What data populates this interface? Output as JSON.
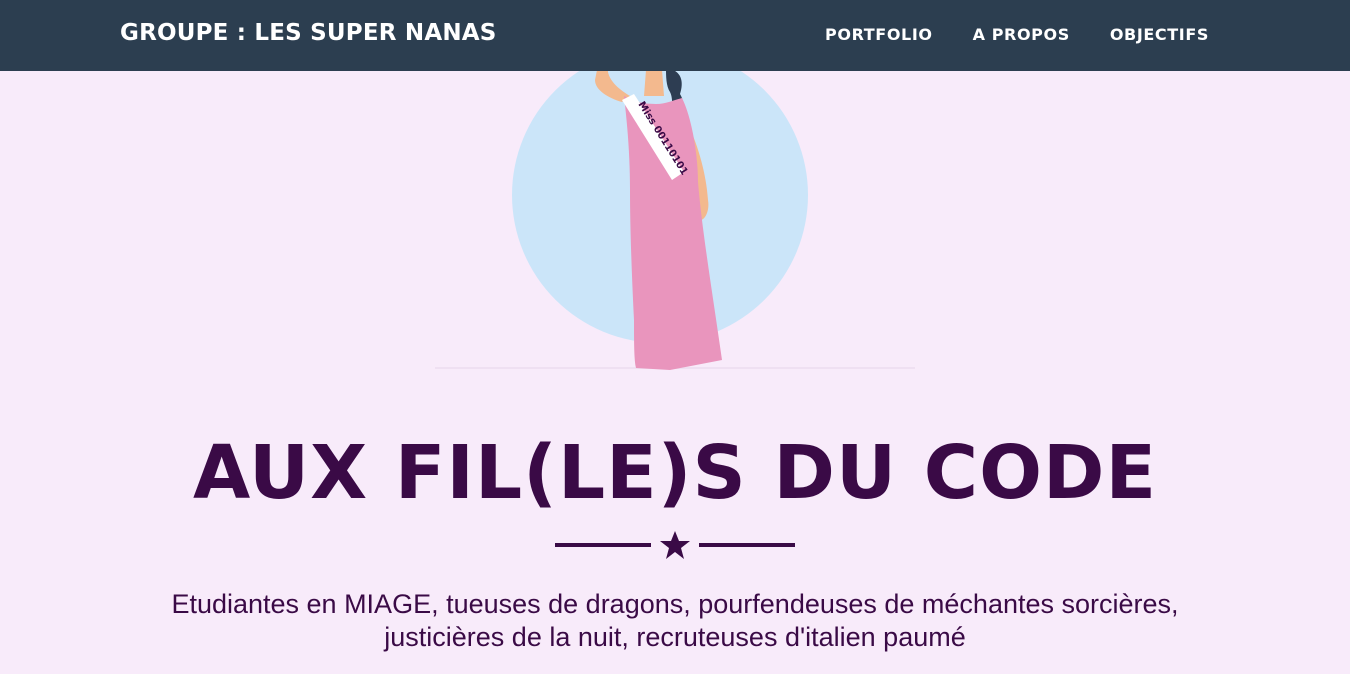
{
  "navbar": {
    "brand": "GROUPE : LES SUPER NANAS",
    "links": [
      {
        "label": "PORTFOLIO"
      },
      {
        "label": "A PROPOS"
      },
      {
        "label": "OBJECTIFS"
      }
    ]
  },
  "hero": {
    "sash_text": "Miss 00110101",
    "title": "AUX FIL(LE)S DU CODE",
    "divider_icon": "star-icon",
    "subtitle_line1": "Etudiantes en MIAGE, tueuses de dragons, pourfendeuses de méchantes sorcières,",
    "subtitle_line2": "justicières de la nuit, recruteuses d'italien paumé"
  },
  "colors": {
    "navbar_bg": "#2c3e50",
    "page_bg": "#f8ebfa",
    "accent_text": "#3a0a46",
    "circle": "#cbe5f9",
    "dress": "#e995bd"
  }
}
